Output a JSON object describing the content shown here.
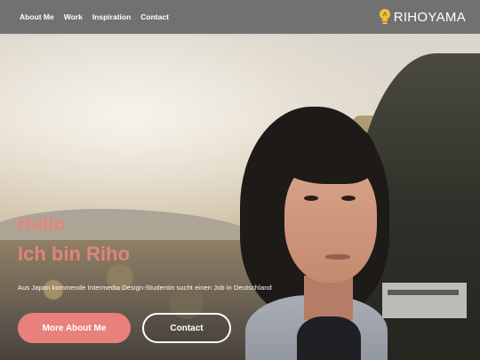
{
  "nav": {
    "links": [
      "About Me",
      "Work",
      "Inspiration",
      "Contact"
    ],
    "brand_text": "RIHOYAMA"
  },
  "hero": {
    "headline_line1": "Hallo",
    "headline_line2": "Ich bin Riho",
    "subline": "Aus Japan kommende Intermedia Design-Studentin sucht einen Job in Deutschland",
    "primary_button": "More About Me",
    "secondary_button": "Contact"
  },
  "colors": {
    "accent": "#e8807b",
    "nav_bg": "#6c6c6c",
    "logo_yellow": "#f2c230"
  },
  "icons": {
    "brand_logo": "lightbulb-icon"
  }
}
